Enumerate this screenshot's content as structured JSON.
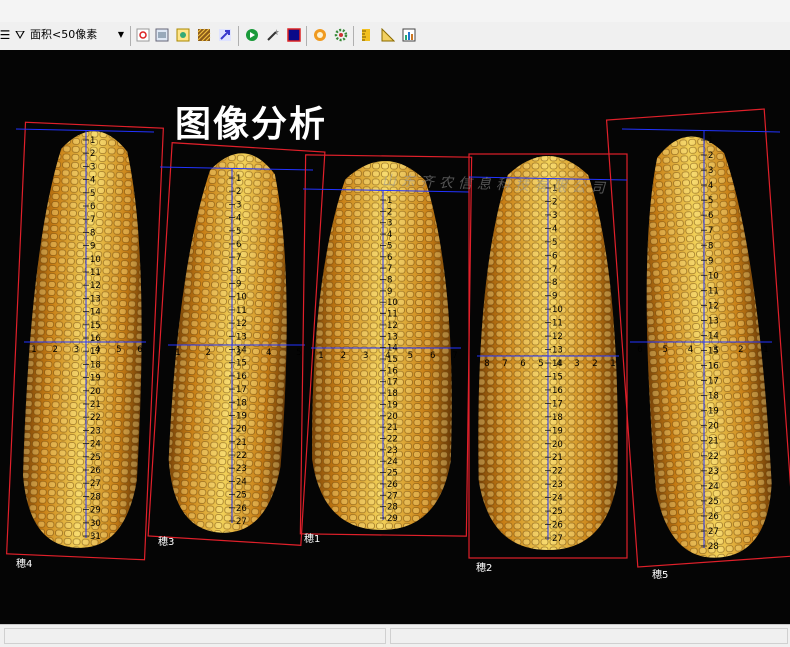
{
  "toolbar": {
    "filter_label": "面积<50像素"
  },
  "canvas": {
    "title": "图像分析",
    "watermark": "山东齐农信息科技有限公司"
  },
  "ears": [
    {
      "label": "穗4",
      "long_ticks": [
        "1",
        "2",
        "3",
        "4",
        "5",
        "6",
        "7",
        "8",
        "9",
        "10",
        "11",
        "12",
        "13",
        "14",
        "15",
        "16",
        "17",
        "18",
        "19",
        "20",
        "21",
        "22",
        "23",
        "24",
        "25",
        "26",
        "27",
        "28",
        "29",
        "30",
        "31"
      ],
      "cross_ticks": [
        "1",
        "2",
        "3",
        "4",
        "5",
        "6"
      ]
    },
    {
      "label": "穗3",
      "long_ticks": [
        "1",
        "2",
        "3",
        "4",
        "5",
        "6",
        "7",
        "8",
        "9",
        "10",
        "11",
        "12",
        "13",
        "14",
        "15",
        "16",
        "17",
        "18",
        "19",
        "20",
        "21",
        "22",
        "23",
        "24",
        "25",
        "26",
        "27"
      ],
      "cross_ticks": [
        "1",
        "2",
        "3",
        "4",
        "5"
      ]
    },
    {
      "label": "穗1",
      "long_ticks": [
        "1",
        "2",
        "3",
        "4",
        "5",
        "6",
        "7",
        "8",
        "9",
        "10",
        "11",
        "12",
        "13",
        "14",
        "15",
        "16",
        "17",
        "18",
        "19",
        "20",
        "21",
        "22",
        "23",
        "24",
        "25",
        "26",
        "27",
        "28",
        "29"
      ],
      "cross_ticks": [
        "1",
        "2",
        "3",
        "4",
        "5",
        "6",
        "7"
      ]
    },
    {
      "label": "穗2",
      "long_ticks": [
        "1",
        "2",
        "3",
        "4",
        "5",
        "6",
        "7",
        "8",
        "9",
        "10",
        "11",
        "12",
        "13",
        "14",
        "15",
        "16",
        "17",
        "18",
        "19",
        "20",
        "21",
        "22",
        "23",
        "24",
        "25",
        "26",
        "27"
      ],
      "cross_ticks": [
        "8",
        "7",
        "6",
        "5",
        "4",
        "3",
        "2",
        "1"
      ]
    },
    {
      "label": "穗5",
      "long_ticks": [
        "1",
        "2",
        "3",
        "4",
        "5",
        "6",
        "7",
        "8",
        "9",
        "10",
        "11",
        "12",
        "13",
        "14",
        "15",
        "16",
        "17",
        "18",
        "19",
        "20",
        "21",
        "22",
        "23",
        "24",
        "25",
        "26",
        "27",
        "28"
      ],
      "cross_ticks": [
        "6",
        "5",
        "4",
        "3",
        "2",
        "1"
      ]
    }
  ],
  "colors": {
    "canvas_bg": "#050505",
    "box": "#e0202a",
    "axis": "#2233ff",
    "kernel_light": "#f3d35a",
    "kernel_dark": "#c77d14",
    "tick_text": "#000000",
    "label": "#ffffff"
  }
}
